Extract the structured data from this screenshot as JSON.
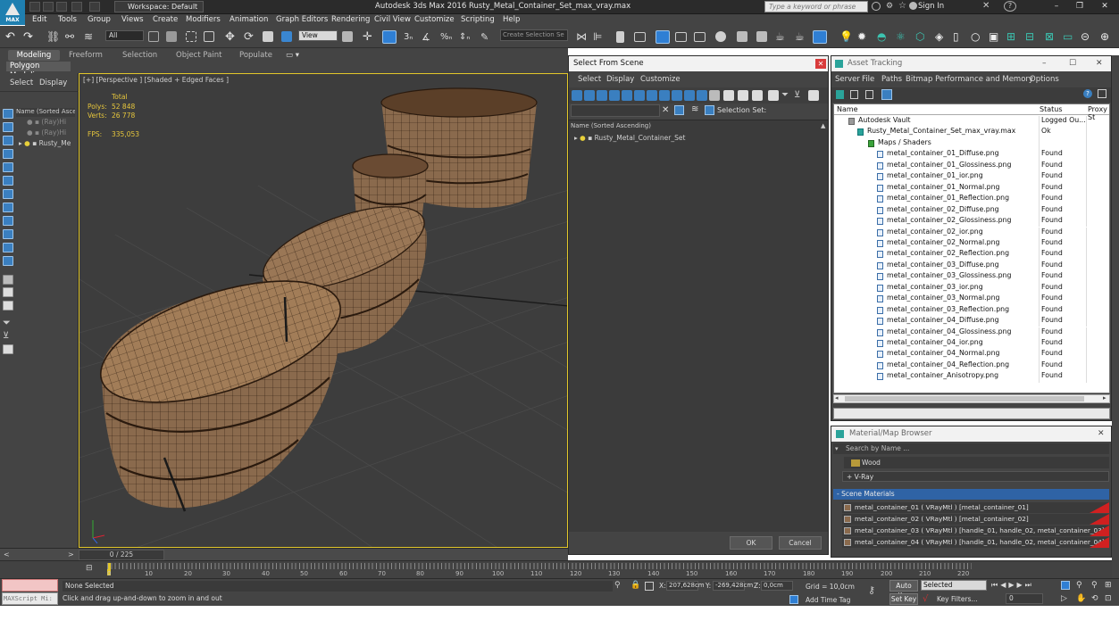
{
  "window": {
    "title": "Autodesk 3ds Max 2016    Rusty_Metal_Container_Set_max_vray.max",
    "workspace": "Workspace: Default",
    "search_placeholder": "Type a keyword or phrase",
    "sign_in": "Sign In",
    "logo_text": "MAX"
  },
  "menu": [
    "Edit",
    "Tools",
    "Group",
    "Views",
    "Create",
    "Modifiers",
    "Animation",
    "Graph Editors",
    "Rendering",
    "Civil View",
    "Customize",
    "Scripting",
    "Help"
  ],
  "toolbar": {
    "selection_filter": "All",
    "reference_coord": "View",
    "create_selection_set": "Create Selection Se"
  },
  "ribbon": {
    "tabs": [
      "Modeling",
      "Freeform",
      "Selection",
      "Object Paint",
      "Populate"
    ],
    "active_tab": "Modeling",
    "sub_label": "Polygon Modeling"
  },
  "scene_explorer": {
    "tabs": [
      "Select",
      "Display"
    ],
    "header": "Name (Sorted Ascen",
    "rows": [
      "(Ray)Hi",
      "(Ray)Hi",
      "Rusty_Me"
    ]
  },
  "viewport": {
    "label": "[+] [Perspective ] [Shaded + Edged Faces ]",
    "stats_total_label": "Total",
    "polys_label": "Polys:",
    "polys_value": "52 848",
    "verts_label": "Verts:",
    "verts_value": "26 778",
    "fps_label": "FPS:",
    "fps_value": "335,053"
  },
  "time_slider": {
    "frame": "0 / 225"
  },
  "track_ticks": [
    "0",
    "10",
    "20",
    "30",
    "40",
    "50",
    "60",
    "70",
    "80",
    "90",
    "100",
    "110",
    "120",
    "130",
    "140",
    "150",
    "160",
    "170",
    "180",
    "190",
    "200",
    "210",
    "220"
  ],
  "status": {
    "maxscript": "MAXScript Mi:",
    "selection": "None Selected",
    "prompt": "Click and drag up-and-down to zoom in and out",
    "x_label": "X:",
    "x_value": "207,628cm",
    "y_label": "Y:",
    "y_value": "-269,428cm",
    "z_label": "Z:",
    "z_value": "0,0cm",
    "grid": "Grid = 10,0cm",
    "add_time_tag": "Add Time Tag",
    "auto_key": "Auto Key",
    "set_key": "Set Key",
    "selected_dropdown": "Selected",
    "key_filters": "Key Filters...",
    "frame_input": "0"
  },
  "select_from_scene": {
    "title": "Select From Scene",
    "menu": [
      "Select",
      "Display",
      "Customize"
    ],
    "selection_set_label": "Selection Set:",
    "column_header": "Name (Sorted Ascending)",
    "item": "Rusty_Metal_Container_Set",
    "ok": "OK",
    "cancel": "Cancel"
  },
  "asset_tracking": {
    "title": "Asset Tracking",
    "menu": [
      "Server",
      "File",
      "Paths",
      "Bitmap Performance and Memory",
      "Options"
    ],
    "columns": [
      "Name",
      "Status",
      "Proxy St"
    ],
    "rows": [
      {
        "name": "Autodesk Vault",
        "status": "Logged Ou...",
        "level": 0
      },
      {
        "name": "Rusty_Metal_Container_Set_max_vray.max",
        "status": "Ok",
        "level": 1
      },
      {
        "name": "Maps / Shaders",
        "status": "",
        "level": 2
      },
      {
        "name": "metal_container_01_Diffuse.png",
        "status": "Found",
        "level": 3
      },
      {
        "name": "metal_container_01_Glossiness.png",
        "status": "Found",
        "level": 3
      },
      {
        "name": "metal_container_01_ior.png",
        "status": "Found",
        "level": 3
      },
      {
        "name": "metal_container_01_Normal.png",
        "status": "Found",
        "level": 3
      },
      {
        "name": "metal_container_01_Reflection.png",
        "status": "Found",
        "level": 3
      },
      {
        "name": "metal_container_02_Diffuse.png",
        "status": "Found",
        "level": 3
      },
      {
        "name": "metal_container_02_Glossiness.png",
        "status": "Found",
        "level": 3
      },
      {
        "name": "metal_container_02_ior.png",
        "status": "Found",
        "level": 3
      },
      {
        "name": "metal_container_02_Normal.png",
        "status": "Found",
        "level": 3
      },
      {
        "name": "metal_container_02_Reflection.png",
        "status": "Found",
        "level": 3
      },
      {
        "name": "metal_container_03_Diffuse.png",
        "status": "Found",
        "level": 3
      },
      {
        "name": "metal_container_03_Glossiness.png",
        "status": "Found",
        "level": 3
      },
      {
        "name": "metal_container_03_ior.png",
        "status": "Found",
        "level": 3
      },
      {
        "name": "metal_container_03_Normal.png",
        "status": "Found",
        "level": 3
      },
      {
        "name": "metal_container_03_Reflection.png",
        "status": "Found",
        "level": 3
      },
      {
        "name": "metal_container_04_Diffuse.png",
        "status": "Found",
        "level": 3
      },
      {
        "name": "metal_container_04_Glossiness.png",
        "status": "Found",
        "level": 3
      },
      {
        "name": "metal_container_04_ior.png",
        "status": "Found",
        "level": 3
      },
      {
        "name": "metal_container_04_Normal.png",
        "status": "Found",
        "level": 3
      },
      {
        "name": "metal_container_04_Reflection.png",
        "status": "Found",
        "level": 3
      },
      {
        "name": "metal_container_Anisotropy.png",
        "status": "Found",
        "level": 3
      }
    ]
  },
  "material_browser": {
    "title": "Material/Map Browser",
    "search_placeholder": "Search by Name ...",
    "library": "Wood",
    "vray_group": "+ V-Ray",
    "scene_materials_header": "- Scene Materials",
    "materials": [
      "metal_container_01  ( VRayMtl )  [metal_container_01]",
      "metal_container_02  ( VRayMtl )  [metal_container_02]",
      "metal_container_03  ( VRayMtl )  [handle_01, handle_02, metal_container_03]",
      "metal_container_04  ( VRayMtl )  [handle_01, handle_02, metal_container_04]"
    ]
  },
  "colors": {
    "accent_blue": "#2f63a5",
    "wire_orange": "#c89a6a",
    "status_red": "#d02020",
    "stats_yellow": "#e6c63d"
  }
}
